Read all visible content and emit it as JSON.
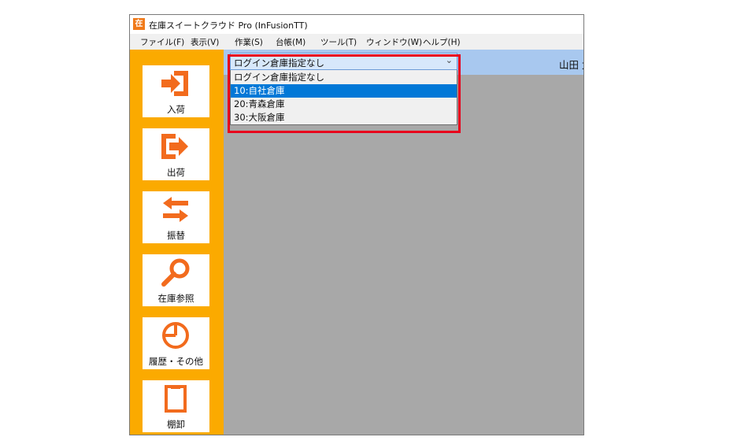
{
  "window": {
    "icon_char": "在",
    "title": "在庫スイートクラウド Pro (InFusionTT)"
  },
  "menubar": [
    {
      "label": "ファイル(F)"
    },
    {
      "label": "表示(V)"
    },
    {
      "label": "作業(S)"
    },
    {
      "label": "台帳(M)"
    },
    {
      "label": "ツール(T)"
    },
    {
      "label": "ウィンドウ(W)"
    },
    {
      "label": "ヘルプ(H)"
    }
  ],
  "sidebar": {
    "items": [
      {
        "label": "入荷",
        "icon": "inbound-icon"
      },
      {
        "label": "出荷",
        "icon": "outbound-icon"
      },
      {
        "label": "振替",
        "icon": "transfer-icon"
      },
      {
        "label": "在庫参照",
        "icon": "search-icon"
      },
      {
        "label": "履歴・その他",
        "icon": "history-icon"
      },
      {
        "label": "棚卸",
        "icon": "stocktake-icon"
      }
    ]
  },
  "warehouse_select": {
    "value": "ログイン倉庫指定なし",
    "arrow": "⌄",
    "options": [
      {
        "label": "ログイン倉庫指定なし",
        "selected": false
      },
      {
        "label": "10:自社倉庫",
        "selected": true
      },
      {
        "label": "20:青森倉庫",
        "selected": false
      },
      {
        "label": "30:大阪倉庫",
        "selected": false
      }
    ]
  },
  "user": {
    "label": "山田 太郎 (t_yamada)"
  },
  "colors": {
    "sidebar": "#fbaa00",
    "icon": "#f26b1d",
    "header": "#a8c8ef",
    "selection": "#0078d7",
    "highlight": "#e8001c",
    "content": "#a8a8a8"
  }
}
